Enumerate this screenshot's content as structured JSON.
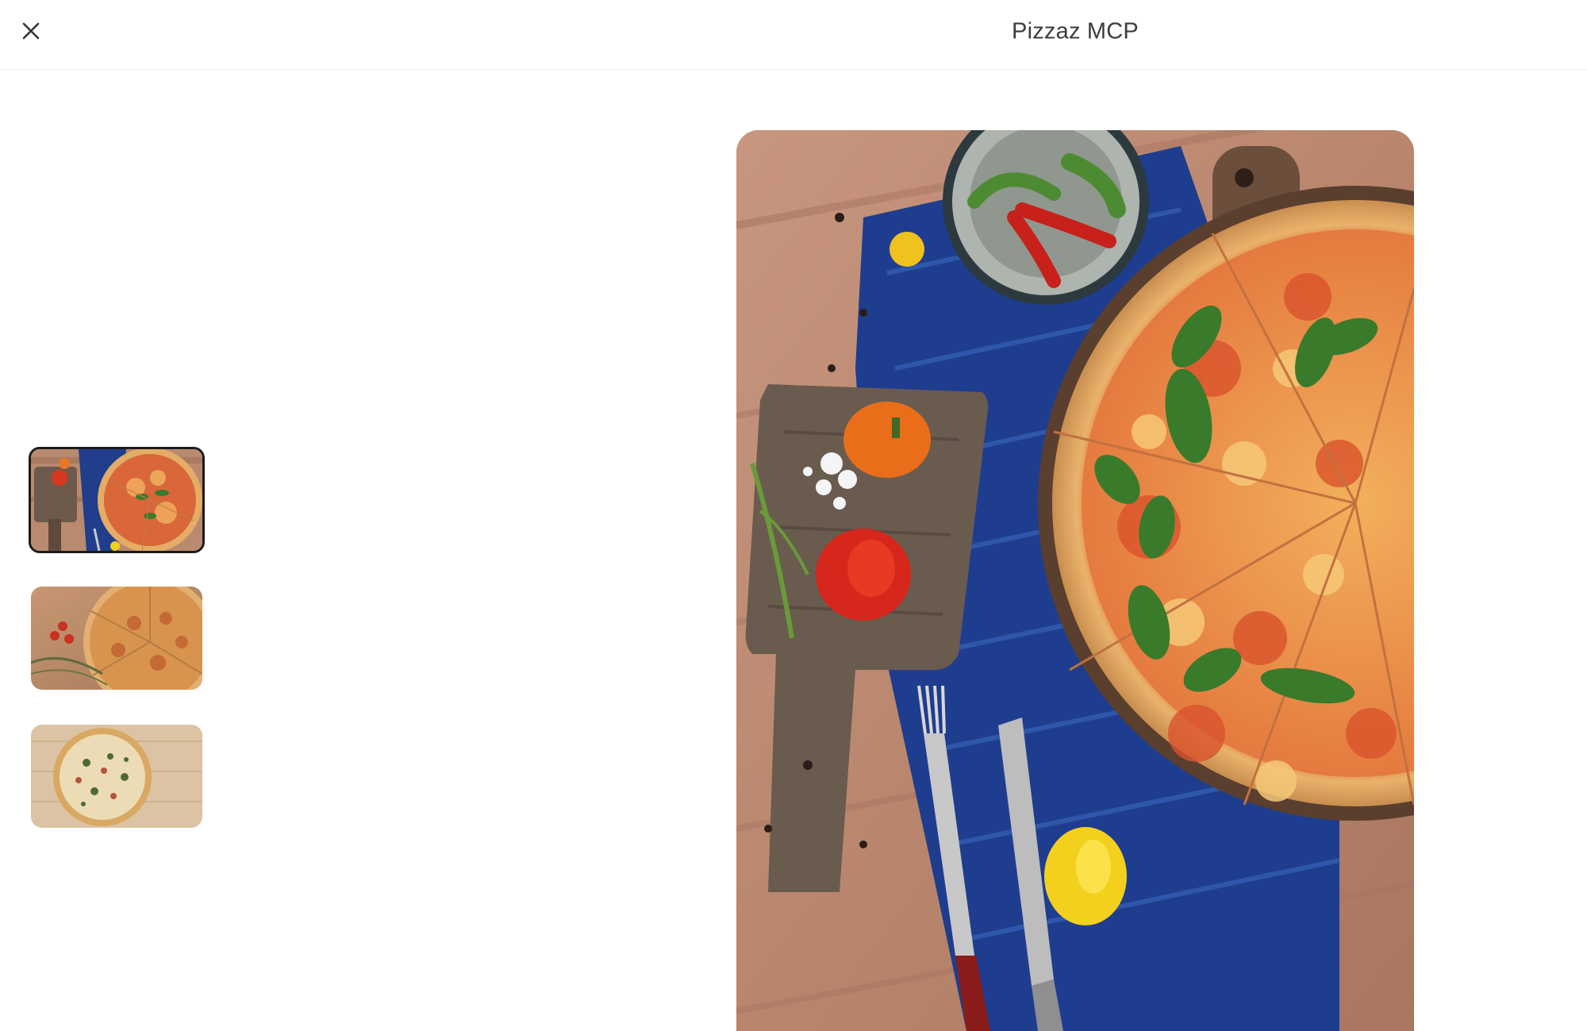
{
  "header": {
    "title": "Pizzaz MCP",
    "close_icon": "close-icon"
  },
  "thumbnails": [
    {
      "id": "thumb-1",
      "selected": true,
      "depicts": "pizza-with-peppers-thumbnail"
    },
    {
      "id": "thumb-2",
      "selected": false,
      "depicts": "pizza-slices-thumbnail"
    },
    {
      "id": "thumb-3",
      "selected": false,
      "depicts": "pizza-on-wood-thumbnail"
    }
  ],
  "hero": {
    "depicts": "pizza-hero-photo"
  },
  "colors": {
    "wood": "#c08e74",
    "cloth": "#1f3f8f",
    "crust": "#e6b06a",
    "sauce": "#d9532c",
    "basil": "#3c7a2b",
    "selected_border": "#1b1b1b"
  }
}
